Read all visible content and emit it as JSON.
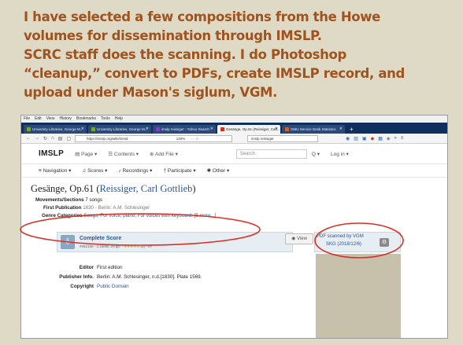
{
  "slide": {
    "lines": [
      "I  have selected a few compositions from the Howe",
      "volumes for dissemination through IMSLP.",
      "SCRC staff does the scanning. I do Photoshop",
      "“cleanup,” convert to PDFs, create IMSLP record, and",
      "upload under Mason's siglum, VGM."
    ],
    "text_color": "#a0531f",
    "background_color": "#dedac6",
    "annotation_color": "#d93025"
  },
  "browser": {
    "menu": [
      "File",
      "Edit",
      "View",
      "History",
      "Bookmarks",
      "Tools",
      "Help"
    ],
    "tabs": [
      {
        "label": "University Libraries, George M...",
        "active": false
      },
      {
        "label": "University Libraries, George M...",
        "active": false
      },
      {
        "label": "imslp reissiger - Yahoo Search",
        "active": false
      },
      {
        "label": "Gesänge, Op.61 (Reissiger, Carl...",
        "active": true
      },
      {
        "label": "GMU Service Desk Statistics",
        "active": false
      }
    ],
    "new_tab": "+",
    "url": "https://imslp.org/wiki/Gesä",
    "zoom": "120%",
    "search": "imslp reissiger"
  },
  "imslp": {
    "logo": "IMSLP",
    "header_links": [
      "Page",
      "Contents",
      "Add File"
    ],
    "search_placeholder": "Search",
    "login": "Log in",
    "nav": [
      "Navigation",
      "Scores",
      "Recordings",
      "Participate",
      "Other"
    ],
    "title_main": "Gesänge, Op.61 (",
    "title_composer": "Reissiger, Carl Gottlieb",
    "title_end": ")",
    "info": {
      "movements_label": "Movements/Sections",
      "movements_value": "7 songs",
      "pub_label": "First Publication",
      "pub_value": "1830 - Berlin: A.M. Schlesinger",
      "genre_label": "Genre Categories",
      "genre_value": "Songs; For voice, piano; For voices with keyboard; [5 more...]"
    },
    "score": {
      "title": "Complete Score",
      "meta": "#552168 - 3.15MB, 20 pp. -",
      "stars": "★★★★★",
      "meta_tail": "(0) - 9×",
      "view": "View",
      "scanned_by": "PDF scanned by VGM",
      "uploader": "SKG (2018/12/6)",
      "gear": "⚙"
    },
    "details": [
      {
        "k": "Editor",
        "v": "First edition",
        "link": false
      },
      {
        "k": "Publisher Info.",
        "v": "Berlin: A.M. Schlesinger, n.d.[1830]. Plate 1569.",
        "link": false
      },
      {
        "k": "Copyright",
        "v": "Public Domain",
        "link": true
      }
    ]
  }
}
